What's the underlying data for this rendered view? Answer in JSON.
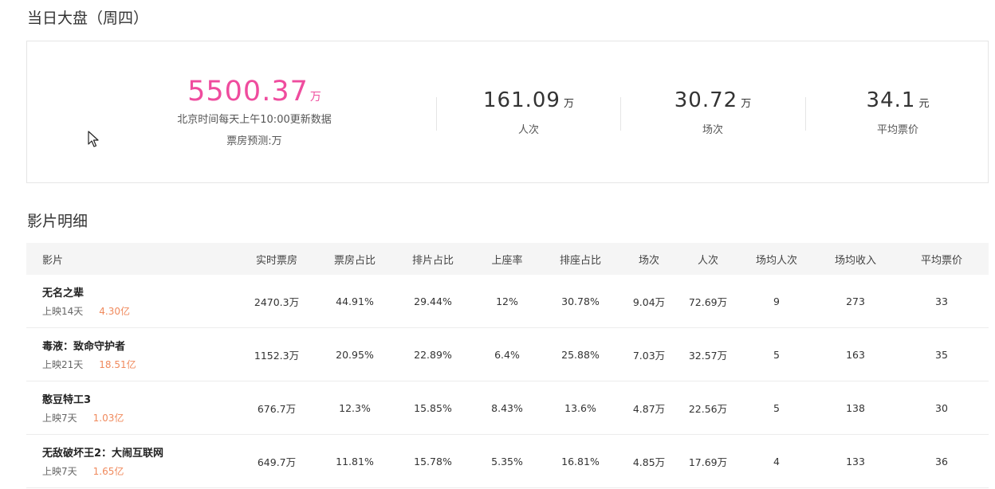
{
  "daily": {
    "title": "当日大盘（周四）",
    "total": {
      "value": "5500.37",
      "unit": "万",
      "update_note": "北京时间每天上午10:00更新数据",
      "forecast": "票房预测:万"
    },
    "stats": [
      {
        "value": "161.09",
        "unit": "万",
        "label": "人次"
      },
      {
        "value": "30.72",
        "unit": "万",
        "label": "场次"
      },
      {
        "value": "34.1",
        "unit": "元",
        "label": "平均票价"
      }
    ]
  },
  "films": {
    "title": "影片明细",
    "headers": [
      "影片",
      "实时票房",
      "票房占比",
      "排片占比",
      "上座率",
      "排座占比",
      "场次",
      "人次",
      "场均人次",
      "场均收入",
      "平均票价"
    ],
    "rows": [
      {
        "name": "无名之辈",
        "days": "上映14天",
        "cumulative": "4.30亿",
        "realtime": "2470.3万",
        "box_share": "44.91%",
        "screening_share": "29.44%",
        "occupancy": "12%",
        "seat_share": "30.78%",
        "shows": "9.04万",
        "admissions": "72.69万",
        "avg_per_show": "9",
        "avg_income": "273",
        "avg_price": "33"
      },
      {
        "name": "毒液：致命守护者",
        "days": "上映21天",
        "cumulative": "18.51亿",
        "realtime": "1152.3万",
        "box_share": "20.95%",
        "screening_share": "22.89%",
        "occupancy": "6.4%",
        "seat_share": "25.88%",
        "shows": "7.03万",
        "admissions": "32.57万",
        "avg_per_show": "5",
        "avg_income": "163",
        "avg_price": "35"
      },
      {
        "name": "憨豆特工3",
        "days": "上映7天",
        "cumulative": "1.03亿",
        "realtime": "676.7万",
        "box_share": "12.3%",
        "screening_share": "15.85%",
        "occupancy": "8.43%",
        "seat_share": "13.6%",
        "shows": "4.87万",
        "admissions": "22.56万",
        "avg_per_show": "5",
        "avg_income": "138",
        "avg_price": "30"
      },
      {
        "name": "无敌破坏王2：大闹互联网",
        "days": "上映7天",
        "cumulative": "1.65亿",
        "realtime": "649.7万",
        "box_share": "11.81%",
        "screening_share": "15.78%",
        "occupancy": "5.35%",
        "seat_share": "16.81%",
        "shows": "4.85万",
        "admissions": "17.69万",
        "avg_per_show": "4",
        "avg_income": "133",
        "avg_price": "36"
      }
    ]
  },
  "colors": {
    "accent_pink": "#ef4c9e",
    "cumulative_orange": "#f08a5d",
    "header_bg": "#f5f5f5"
  },
  "icons": {
    "cursor": "mouse-pointer-icon"
  }
}
